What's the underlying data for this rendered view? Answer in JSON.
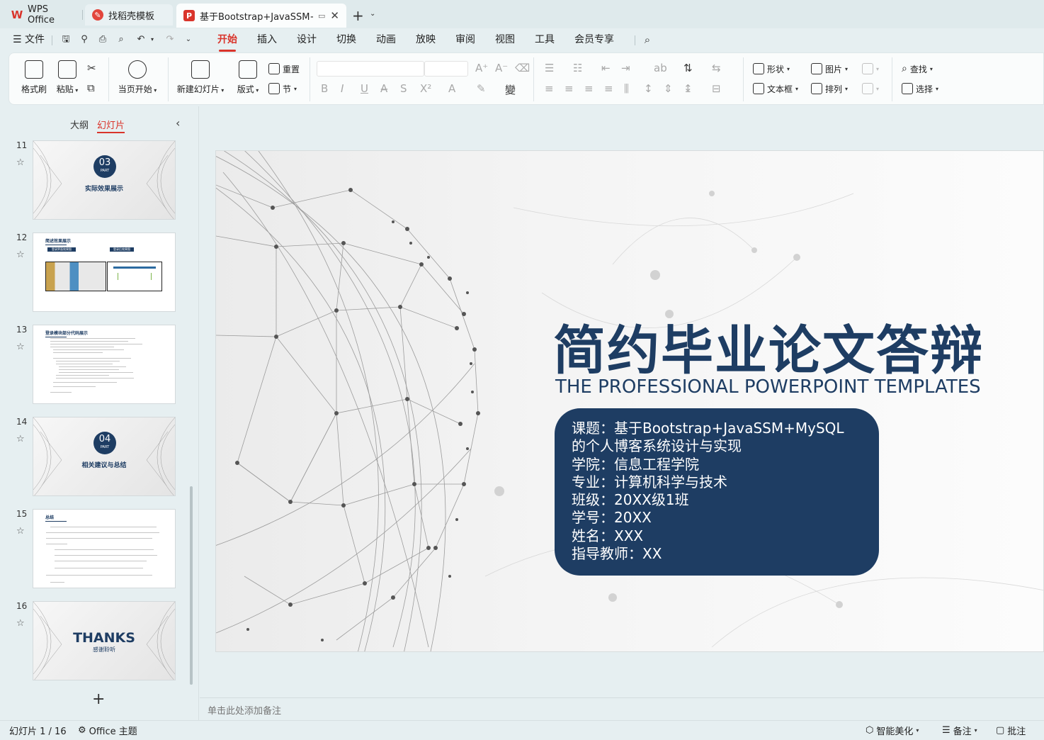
{
  "tabs": [
    {
      "label": "WPS Office"
    },
    {
      "label": "找稻壳模板"
    },
    {
      "label": "基于Bootstrap+JavaSSM+M"
    }
  ],
  "menu": {
    "file": "文件",
    "items": [
      "开始",
      "插入",
      "设计",
      "切换",
      "动画",
      "放映",
      "审阅",
      "视图",
      "工具",
      "会员专享"
    ],
    "active": "开始"
  },
  "ribbon": {
    "format_painter": "格式刷",
    "paste": "粘贴",
    "from_current": "当页开始",
    "new_slide": "新建幻灯片",
    "layout": "版式",
    "reset": "重置",
    "section": "节",
    "shape": "形状",
    "picture": "图片",
    "find": "查找",
    "textbox": "文本框",
    "arrange": "排列",
    "select": "选择"
  },
  "panel": {
    "outline_tab": "大纲",
    "slides_tab": "幻灯片"
  },
  "thumbnails": [
    {
      "num": "11",
      "part": "03",
      "part_label": "PART",
      "caption": "实际效果展示"
    },
    {
      "num": "12",
      "heading": "简述效果展示",
      "label_a": "登录界面效果图",
      "label_b": "登录后效果图"
    },
    {
      "num": "13",
      "heading": "登录模块部分代码展示"
    },
    {
      "num": "14",
      "part": "04",
      "part_label": "PART",
      "caption": "相关建议与总结"
    },
    {
      "num": "15",
      "heading": "总结"
    },
    {
      "num": "16",
      "thanks": "THANKS",
      "thanks_sub": "感谢聆听"
    }
  ],
  "slide": {
    "title": "简约毕业论文答辩",
    "subtitle": "THE PROFESSIONAL POWERPOINT TEMPLATES",
    "info": [
      "课题：基于Bootstrap+JavaSSM+MySQL",
      "的个人博客系统设计与实现",
      "学院：信息工程学院",
      "专业：计算机科学与技术",
      "班级：20XX级1班",
      "学号：20XX",
      "姓名：XXX",
      "指导教师：XX"
    ]
  },
  "notes_placeholder": "单击此处添加备注",
  "status": {
    "slide_counter": "幻灯片 1 / 16",
    "theme": "Office 主题",
    "beautify": "智能美化",
    "notes": "备注",
    "comments": "批注"
  },
  "colors": {
    "accent": "#d9342b",
    "slide_navy": "#1e3d63",
    "app_bg": "#e6eff1"
  }
}
